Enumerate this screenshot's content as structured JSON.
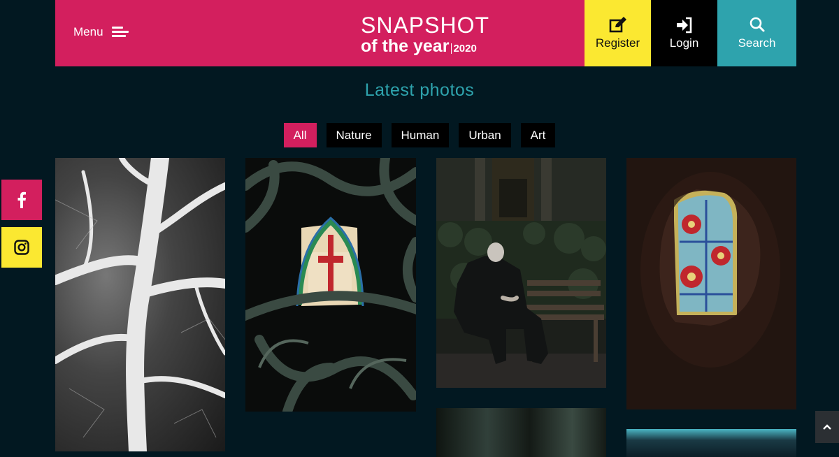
{
  "header": {
    "menu_label": "Menu",
    "logo_top": "SNAPSHOT",
    "logo_bottom": "of the year",
    "logo_year": "2020",
    "register_label": "Register",
    "login_label": "Login",
    "search_label": "Search"
  },
  "main": {
    "title": "Latest photos",
    "filters": [
      "All",
      "Nature",
      "Human",
      "Urban",
      "Art"
    ],
    "active_filter": "All"
  },
  "social": {
    "facebook_icon": "facebook-icon",
    "instagram_icon": "instagram-icon"
  },
  "colors": {
    "background": "#021821",
    "brand_pink": "#d31f5e",
    "brand_yellow": "#fbe831",
    "brand_teal": "#2ea3ad"
  },
  "photos": [
    {
      "subject": "leaf-veins-bw"
    },
    {
      "subject": "stained-glass-behind-ironwork"
    },
    {
      "subject": "man-on-bench"
    },
    {
      "subject": "stained-glass-window-blur"
    },
    {
      "subject": "ironwork-detail"
    },
    {
      "subject": "urban-ceiling-lights"
    }
  ]
}
